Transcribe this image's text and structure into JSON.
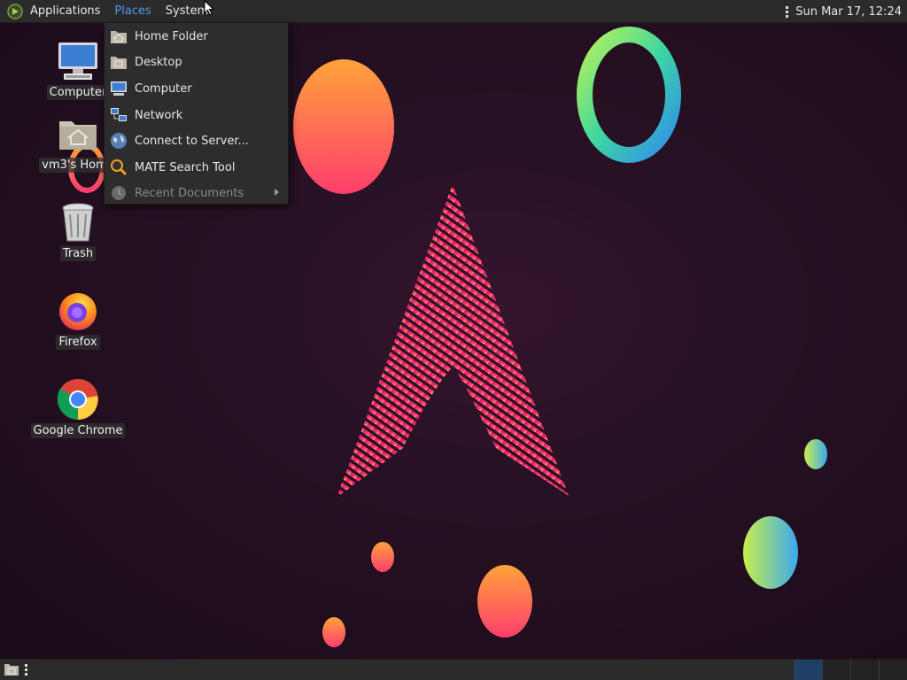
{
  "top_panel": {
    "menus": [
      "Applications",
      "Places",
      "System"
    ],
    "active_menu": "Places",
    "clock": "Sun Mar 17, 12:24"
  },
  "places_menu": {
    "items": [
      {
        "label": "Home Folder",
        "icon": "home-folder-icon",
        "enabled": true
      },
      {
        "label": "Desktop",
        "icon": "desktop-folder-icon",
        "enabled": true
      },
      {
        "label": "Computer",
        "icon": "computer-icon",
        "enabled": true
      },
      {
        "label": "Network",
        "icon": "network-icon",
        "enabled": true
      },
      {
        "label": "Connect to Server...",
        "icon": "globe-icon",
        "enabled": true
      },
      {
        "label": "MATE Search Tool",
        "icon": "search-icon",
        "enabled": true
      },
      {
        "label": "Recent Documents",
        "icon": "clock-icon",
        "enabled": false,
        "submenu": true
      }
    ]
  },
  "desktop_icons": [
    {
      "label": "Computer",
      "icon": "computer-icon"
    },
    {
      "label": "vm3's Home",
      "icon": "home-folder-icon"
    },
    {
      "label": "Trash",
      "icon": "trash-icon"
    },
    {
      "label": "Firefox",
      "icon": "firefox-icon"
    },
    {
      "label": "Google Chrome",
      "icon": "chrome-icon"
    }
  ],
  "colors": {
    "panel_bg": "#2b2b2b",
    "active_menu": "#4d9be6",
    "desktop_bg": "#251022",
    "active_workspace": "#1f3f66"
  }
}
